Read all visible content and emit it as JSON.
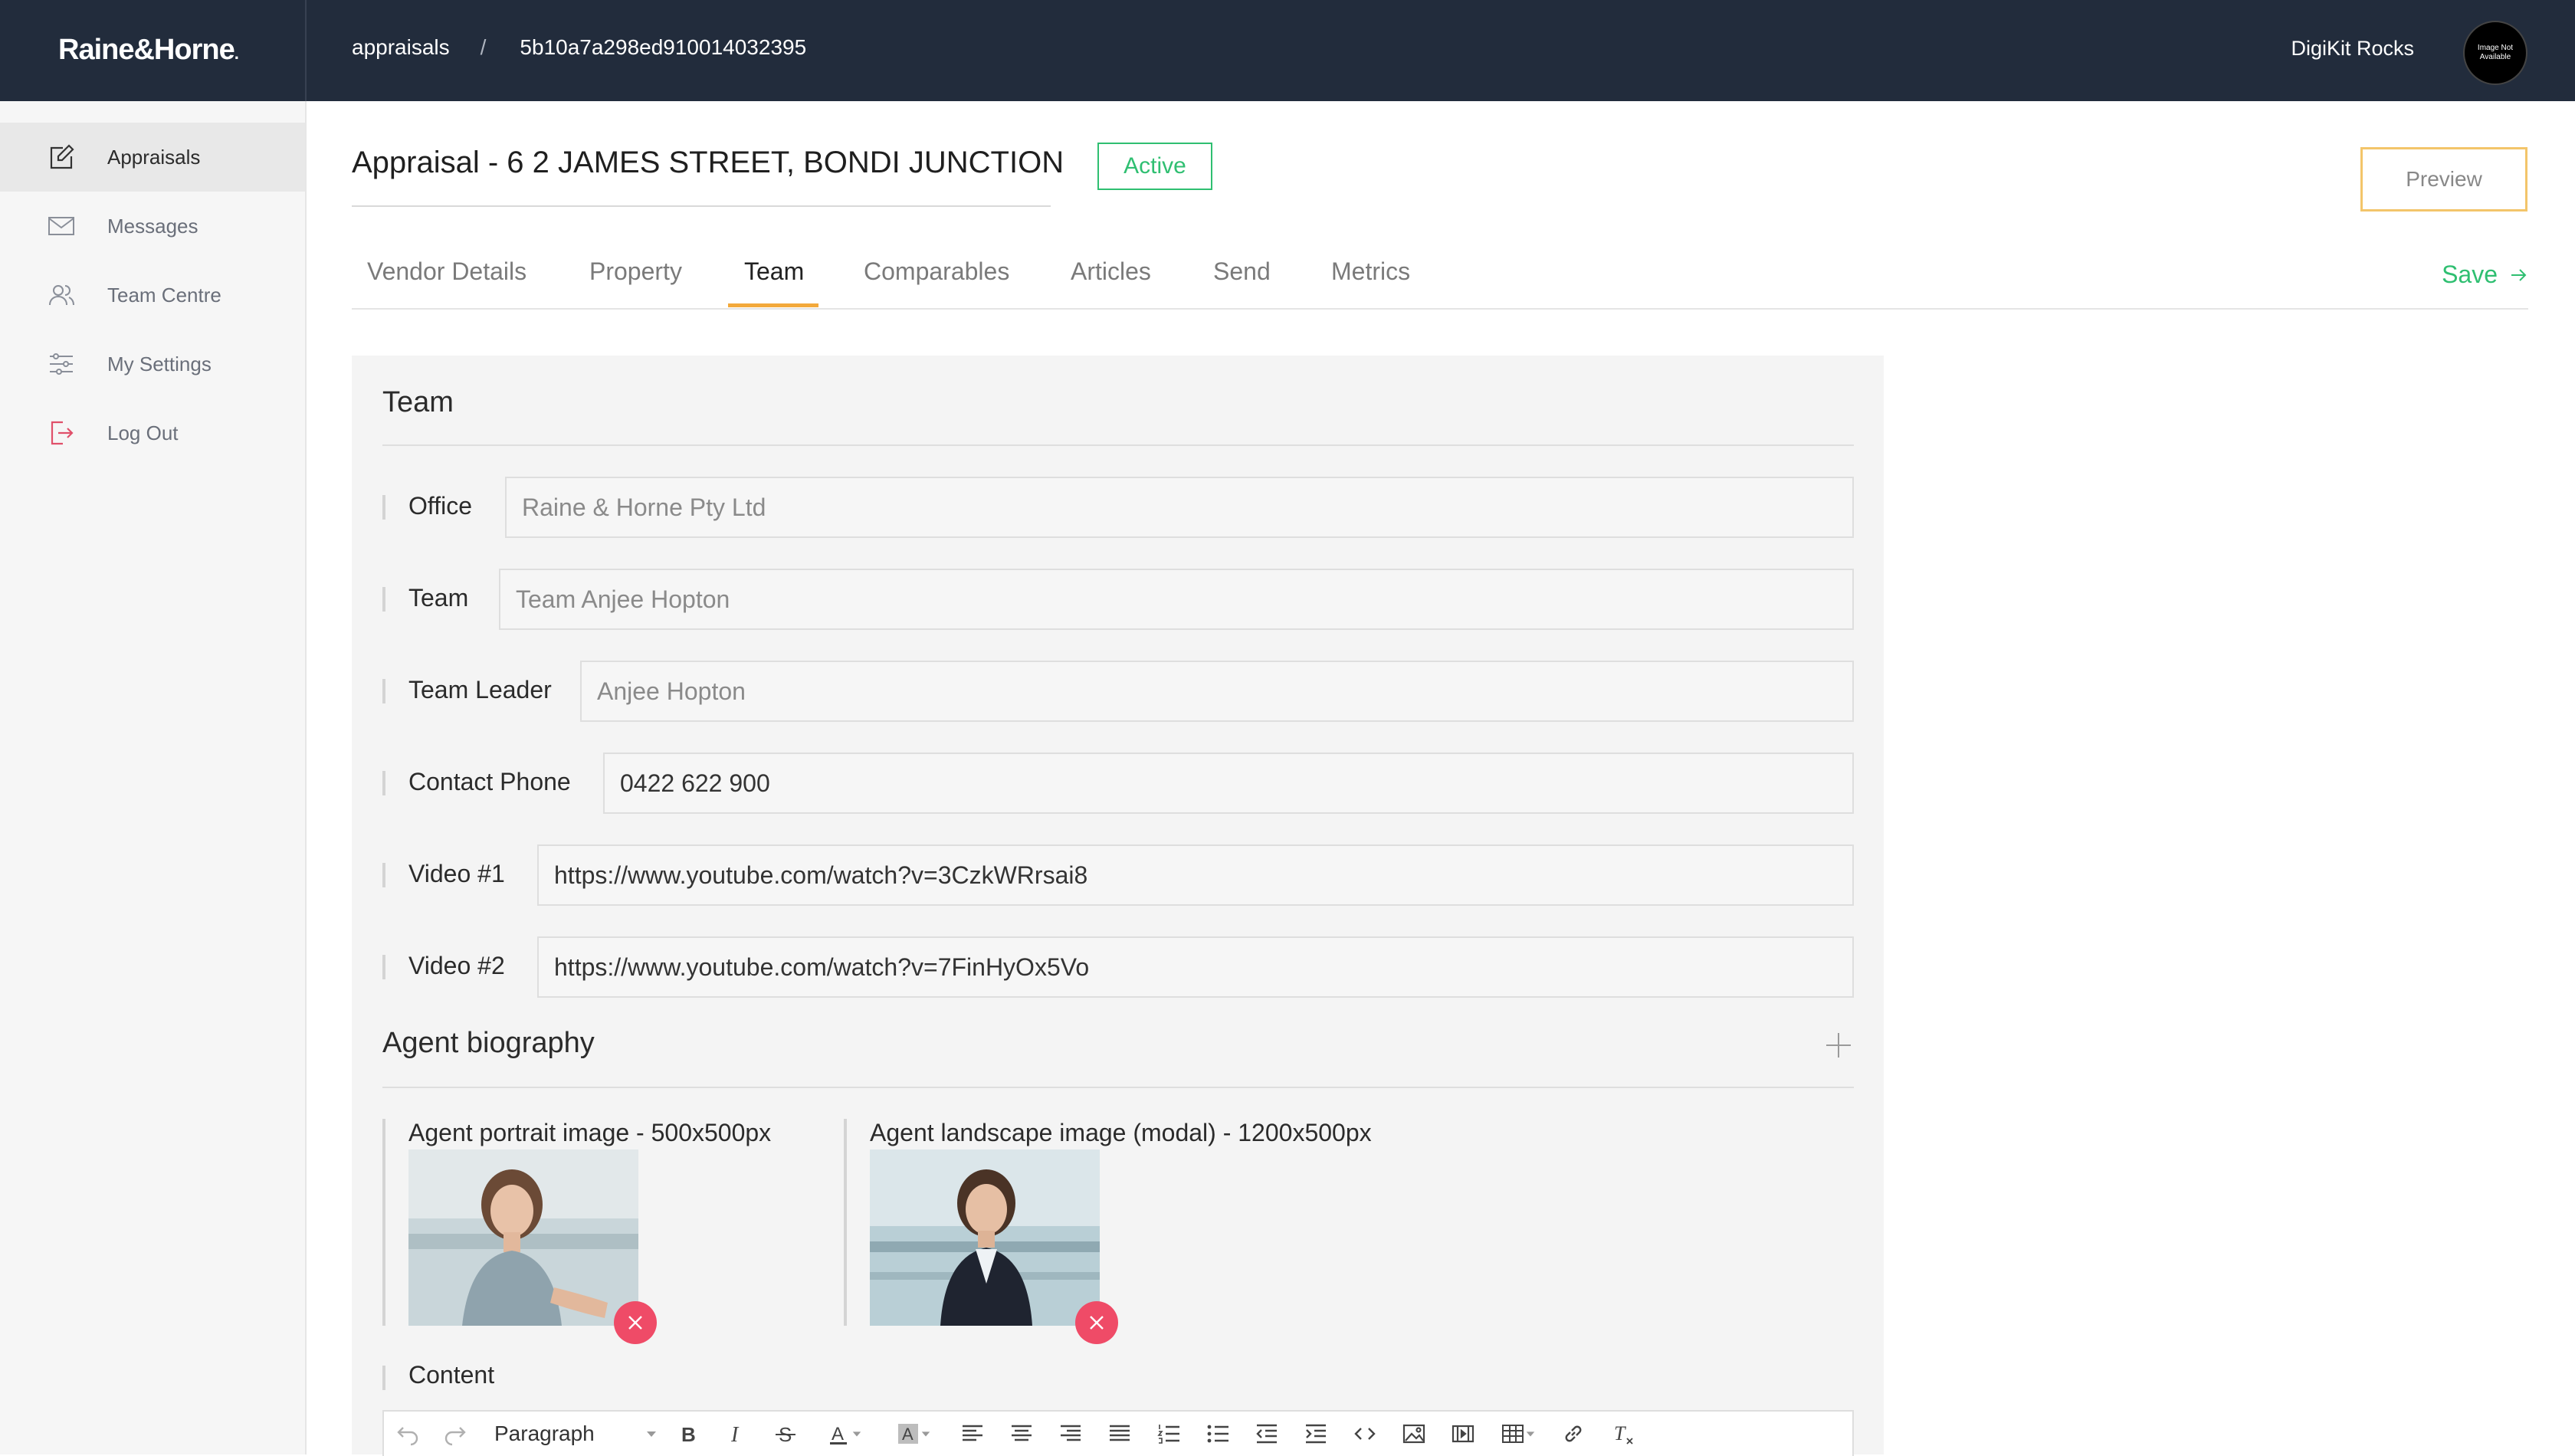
{
  "topbar": {
    "logo": "Raine&Horne",
    "logo_mark": ".",
    "breadcrumb": {
      "first": "appraisals",
      "separator": "/",
      "second": "5b10a7a298ed910014032395"
    },
    "user_name": "DigiKit Rocks",
    "avatar_text": "Image Not Available"
  },
  "sidebar": {
    "items": [
      {
        "label": "Appraisals",
        "icon": "edit-icon"
      },
      {
        "label": "Messages",
        "icon": "envelope-icon"
      },
      {
        "label": "Team Centre",
        "icon": "users-icon"
      },
      {
        "label": "My Settings",
        "icon": "sliders-icon"
      },
      {
        "label": "Log Out",
        "icon": "logout-icon"
      }
    ]
  },
  "header": {
    "title": "Appraisal - 6 2 JAMES STREET, BONDI JUNCTION",
    "status": "Active",
    "preview_label": "Preview",
    "save_label": "Save"
  },
  "tabs": [
    "Vendor Details",
    "Property",
    "Team",
    "Comparables",
    "Articles",
    "Send",
    "Metrics"
  ],
  "active_tab": "Team",
  "team_section": {
    "heading": "Team",
    "fields": [
      {
        "label": "Office",
        "value": "Raine & Horne Pty Ltd"
      },
      {
        "label": "Team",
        "value": "Team Anjee Hopton"
      },
      {
        "label": "Team Leader",
        "value": "Anjee Hopton"
      },
      {
        "label": "Contact Phone",
        "value": "0422 622 900"
      },
      {
        "label": "Video #1",
        "value": "https://www.youtube.com/watch?v=3CzkWRrsai8"
      },
      {
        "label": "Video #2",
        "value": "https://www.youtube.com/watch?v=7FinHyOx5Vo"
      }
    ]
  },
  "biography": {
    "heading": "Agent biography",
    "portrait_label": "Agent portrait image - 500x500px",
    "landscape_label": "Agent landscape image (modal) - 1200x500px",
    "content_label": "Content",
    "format_select": "Paragraph"
  },
  "colors": {
    "topbar": "#222c3c",
    "accent_green": "#2fbf71",
    "tab_indicator": "#f3a93b",
    "preview_border": "#f3c56a",
    "remove_red": "#ef4b67"
  }
}
